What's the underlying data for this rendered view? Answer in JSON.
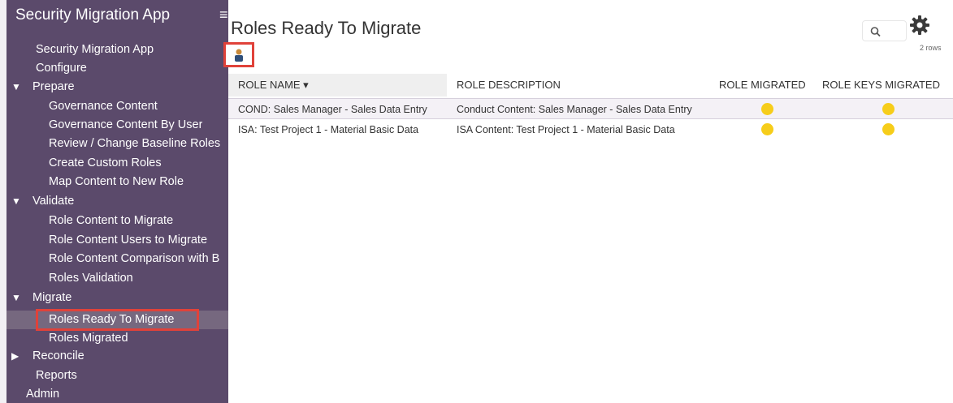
{
  "sidebar": {
    "app_title": "Security Migration App",
    "menu_icon": "hamburger-menu-icon",
    "items": [
      {
        "label": "Security Migration App"
      },
      {
        "label": "Configure"
      },
      {
        "label": "Prepare",
        "arrow": "▼"
      },
      {
        "label": "Governance Content"
      },
      {
        "label": "Governance Content By User"
      },
      {
        "label": "Review / Change Baseline Roles"
      },
      {
        "label": "Create Custom Roles"
      },
      {
        "label": "Map Content to New Role"
      },
      {
        "label": "Validate",
        "arrow": "▼"
      },
      {
        "label": "Role Content to Migrate"
      },
      {
        "label": "Role Content Users to Migrate"
      },
      {
        "label": "Role Content Comparison with B"
      },
      {
        "label": "Roles Validation"
      },
      {
        "label": "Migrate",
        "arrow": "▼"
      },
      {
        "label": "Roles Ready To Migrate"
      },
      {
        "label": "Roles Migrated"
      },
      {
        "label": "Reconcile",
        "arrow": "▶"
      },
      {
        "label": "Reports"
      },
      {
        "label": "Admin"
      }
    ]
  },
  "main": {
    "title": "Roles Ready To Migrate",
    "rows_count": "2 rows",
    "icons": {
      "user": "user-icon",
      "search": "search-icon",
      "settings": "gear-icon"
    }
  },
  "table": {
    "headers": {
      "role_name": "ROLE NAME ▾",
      "role_description": "ROLE DESCRIPTION",
      "role_migrated": "ROLE MIGRATED",
      "role_keys_migrated": "ROLE KEYS MIGRATED"
    },
    "rows": [
      {
        "role_name": "COND: Sales Manager - Sales Data Entry",
        "role_description": "Conduct Content: Sales Manager - Sales Data Entry",
        "role_migrated": "pending",
        "role_keys_migrated": "pending"
      },
      {
        "role_name": "ISA: Test Project 1 - Material Basic Data",
        "role_description": "ISA Content: Test Project 1 - Material Basic Data",
        "role_migrated": "pending",
        "role_keys_migrated": "pending"
      }
    ]
  },
  "colors": {
    "sidebar_bg": "#5b4a6b",
    "status_dot": "#f6cd1a",
    "highlight": "#e0423a"
  }
}
